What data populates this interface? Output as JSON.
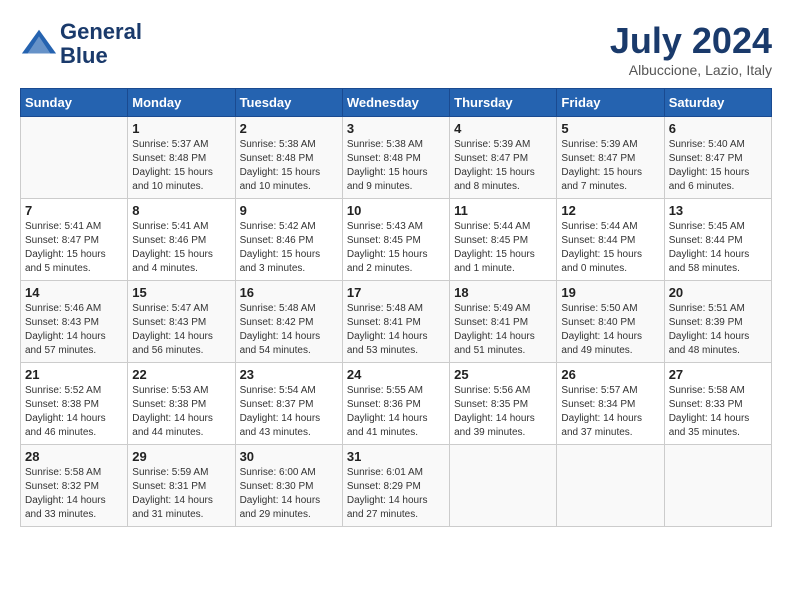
{
  "logo": {
    "line1": "General",
    "line2": "Blue"
  },
  "title": "July 2024",
  "subtitle": "Albuccione, Lazio, Italy",
  "headers": [
    "Sunday",
    "Monday",
    "Tuesday",
    "Wednesday",
    "Thursday",
    "Friday",
    "Saturday"
  ],
  "weeks": [
    [
      {
        "day": "",
        "sunrise": "",
        "sunset": "",
        "daylight": ""
      },
      {
        "day": "1",
        "sunrise": "Sunrise: 5:37 AM",
        "sunset": "Sunset: 8:48 PM",
        "daylight": "Daylight: 15 hours and 10 minutes."
      },
      {
        "day": "2",
        "sunrise": "Sunrise: 5:38 AM",
        "sunset": "Sunset: 8:48 PM",
        "daylight": "Daylight: 15 hours and 10 minutes."
      },
      {
        "day": "3",
        "sunrise": "Sunrise: 5:38 AM",
        "sunset": "Sunset: 8:48 PM",
        "daylight": "Daylight: 15 hours and 9 minutes."
      },
      {
        "day": "4",
        "sunrise": "Sunrise: 5:39 AM",
        "sunset": "Sunset: 8:47 PM",
        "daylight": "Daylight: 15 hours and 8 minutes."
      },
      {
        "day": "5",
        "sunrise": "Sunrise: 5:39 AM",
        "sunset": "Sunset: 8:47 PM",
        "daylight": "Daylight: 15 hours and 7 minutes."
      },
      {
        "day": "6",
        "sunrise": "Sunrise: 5:40 AM",
        "sunset": "Sunset: 8:47 PM",
        "daylight": "Daylight: 15 hours and 6 minutes."
      }
    ],
    [
      {
        "day": "7",
        "sunrise": "Sunrise: 5:41 AM",
        "sunset": "Sunset: 8:47 PM",
        "daylight": "Daylight: 15 hours and 5 minutes."
      },
      {
        "day": "8",
        "sunrise": "Sunrise: 5:41 AM",
        "sunset": "Sunset: 8:46 PM",
        "daylight": "Daylight: 15 hours and 4 minutes."
      },
      {
        "day": "9",
        "sunrise": "Sunrise: 5:42 AM",
        "sunset": "Sunset: 8:46 PM",
        "daylight": "Daylight: 15 hours and 3 minutes."
      },
      {
        "day": "10",
        "sunrise": "Sunrise: 5:43 AM",
        "sunset": "Sunset: 8:45 PM",
        "daylight": "Daylight: 15 hours and 2 minutes."
      },
      {
        "day": "11",
        "sunrise": "Sunrise: 5:44 AM",
        "sunset": "Sunset: 8:45 PM",
        "daylight": "Daylight: 15 hours and 1 minute."
      },
      {
        "day": "12",
        "sunrise": "Sunrise: 5:44 AM",
        "sunset": "Sunset: 8:44 PM",
        "daylight": "Daylight: 15 hours and 0 minutes."
      },
      {
        "day": "13",
        "sunrise": "Sunrise: 5:45 AM",
        "sunset": "Sunset: 8:44 PM",
        "daylight": "Daylight: 14 hours and 58 minutes."
      }
    ],
    [
      {
        "day": "14",
        "sunrise": "Sunrise: 5:46 AM",
        "sunset": "Sunset: 8:43 PM",
        "daylight": "Daylight: 14 hours and 57 minutes."
      },
      {
        "day": "15",
        "sunrise": "Sunrise: 5:47 AM",
        "sunset": "Sunset: 8:43 PM",
        "daylight": "Daylight: 14 hours and 56 minutes."
      },
      {
        "day": "16",
        "sunrise": "Sunrise: 5:48 AM",
        "sunset": "Sunset: 8:42 PM",
        "daylight": "Daylight: 14 hours and 54 minutes."
      },
      {
        "day": "17",
        "sunrise": "Sunrise: 5:48 AM",
        "sunset": "Sunset: 8:41 PM",
        "daylight": "Daylight: 14 hours and 53 minutes."
      },
      {
        "day": "18",
        "sunrise": "Sunrise: 5:49 AM",
        "sunset": "Sunset: 8:41 PM",
        "daylight": "Daylight: 14 hours and 51 minutes."
      },
      {
        "day": "19",
        "sunrise": "Sunrise: 5:50 AM",
        "sunset": "Sunset: 8:40 PM",
        "daylight": "Daylight: 14 hours and 49 minutes."
      },
      {
        "day": "20",
        "sunrise": "Sunrise: 5:51 AM",
        "sunset": "Sunset: 8:39 PM",
        "daylight": "Daylight: 14 hours and 48 minutes."
      }
    ],
    [
      {
        "day": "21",
        "sunrise": "Sunrise: 5:52 AM",
        "sunset": "Sunset: 8:38 PM",
        "daylight": "Daylight: 14 hours and 46 minutes."
      },
      {
        "day": "22",
        "sunrise": "Sunrise: 5:53 AM",
        "sunset": "Sunset: 8:38 PM",
        "daylight": "Daylight: 14 hours and 44 minutes."
      },
      {
        "day": "23",
        "sunrise": "Sunrise: 5:54 AM",
        "sunset": "Sunset: 8:37 PM",
        "daylight": "Daylight: 14 hours and 43 minutes."
      },
      {
        "day": "24",
        "sunrise": "Sunrise: 5:55 AM",
        "sunset": "Sunset: 8:36 PM",
        "daylight": "Daylight: 14 hours and 41 minutes."
      },
      {
        "day": "25",
        "sunrise": "Sunrise: 5:56 AM",
        "sunset": "Sunset: 8:35 PM",
        "daylight": "Daylight: 14 hours and 39 minutes."
      },
      {
        "day": "26",
        "sunrise": "Sunrise: 5:57 AM",
        "sunset": "Sunset: 8:34 PM",
        "daylight": "Daylight: 14 hours and 37 minutes."
      },
      {
        "day": "27",
        "sunrise": "Sunrise: 5:58 AM",
        "sunset": "Sunset: 8:33 PM",
        "daylight": "Daylight: 14 hours and 35 minutes."
      }
    ],
    [
      {
        "day": "28",
        "sunrise": "Sunrise: 5:58 AM",
        "sunset": "Sunset: 8:32 PM",
        "daylight": "Daylight: 14 hours and 33 minutes."
      },
      {
        "day": "29",
        "sunrise": "Sunrise: 5:59 AM",
        "sunset": "Sunset: 8:31 PM",
        "daylight": "Daylight: 14 hours and 31 minutes."
      },
      {
        "day": "30",
        "sunrise": "Sunrise: 6:00 AM",
        "sunset": "Sunset: 8:30 PM",
        "daylight": "Daylight: 14 hours and 29 minutes."
      },
      {
        "day": "31",
        "sunrise": "Sunrise: 6:01 AM",
        "sunset": "Sunset: 8:29 PM",
        "daylight": "Daylight: 14 hours and 27 minutes."
      },
      {
        "day": "",
        "sunrise": "",
        "sunset": "",
        "daylight": ""
      },
      {
        "day": "",
        "sunrise": "",
        "sunset": "",
        "daylight": ""
      },
      {
        "day": "",
        "sunrise": "",
        "sunset": "",
        "daylight": ""
      }
    ]
  ]
}
